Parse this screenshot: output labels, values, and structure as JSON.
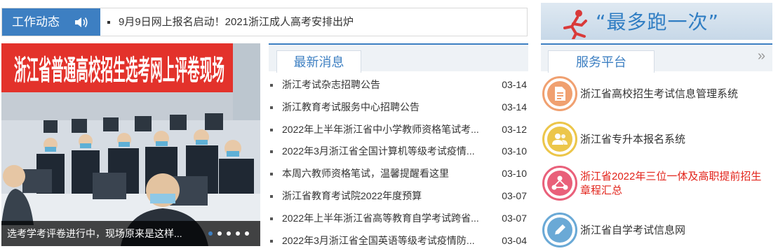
{
  "ticker": {
    "label": "工作动态",
    "headline": "9月9日网上报名启动！2021浙江成人高考安排出炉"
  },
  "carousel": {
    "banner_text": "浙江省普通高校招生选考网上评卷现场",
    "caption": "选考学考评卷进行中，现场原来是这样...",
    "slide_count": 5,
    "active_slide": 1
  },
  "news": {
    "tab_label": "最新消息",
    "items": [
      {
        "title": "浙江考试杂志招聘公告",
        "date": "03-14"
      },
      {
        "title": "浙江教育考试服务中心招聘公告",
        "date": "03-14"
      },
      {
        "title": "2022年上半年浙江省中小学教师资格笔试考...",
        "date": "03-12"
      },
      {
        "title": "2022年3月浙江省全国计算机等级考试疫情...",
        "date": "03-10"
      },
      {
        "title": "本周六教师资格笔试，温馨提醒看这里",
        "date": "03-10"
      },
      {
        "title": "浙江省教育考试院2022年度预算",
        "date": "03-07"
      },
      {
        "title": "2022年上半年浙江省高等教育自学考试跨省...",
        "date": "03-07"
      },
      {
        "title": "2022年3月浙江省全国英语等级考试疫情防...",
        "date": "03-04"
      }
    ]
  },
  "banner": {
    "text": "“最多跑一次”"
  },
  "service": {
    "tab_label": "服务平台",
    "more_glyph": "»",
    "items": [
      {
        "label": "浙江省高校招生考试信息管理系统",
        "icon": "document-icon",
        "color": "#f0a070",
        "highlight": false
      },
      {
        "label": "浙江省专升本报名系统",
        "icon": "users-icon",
        "color": "#ecc64a",
        "highlight": false
      },
      {
        "label": "浙江省2022年三位一体及高职提前招生章程汇总",
        "icon": "network-icon",
        "color": "#e9607a",
        "highlight": true
      },
      {
        "label": "浙江省自学考试信息网",
        "icon": "pencil-icon",
        "color": "#6aa9d6",
        "highlight": false
      }
    ]
  },
  "colors": {
    "accent": "#3d7fc2",
    "highlight_text": "#e2231a"
  }
}
